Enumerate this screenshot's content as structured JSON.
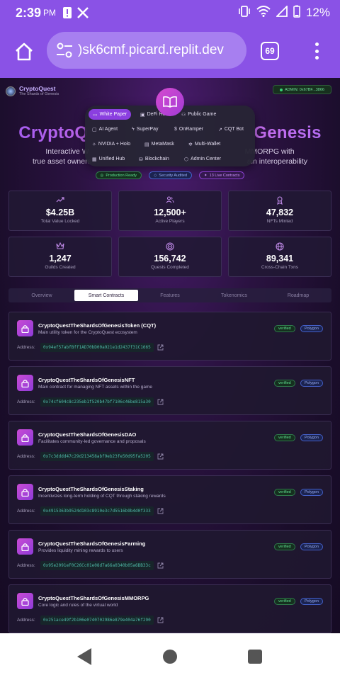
{
  "status_bar": {
    "time": "2:39",
    "ampm": "PM",
    "battery": "12%"
  },
  "browser": {
    "url": ")sk6cmf.picard.replit.dev",
    "tab_count": "69"
  },
  "site": {
    "brand_name": "CryptoQuest",
    "brand_sub": "The Shards of Genesis",
    "admin_label": "ADMIN: 0x67BF...3866",
    "hero_title": "CryptoQuest: The Shards of Genesis",
    "hero_title_left": "CryptoQ",
    "hero_title_right": "Genesis",
    "hero_desc_l1_left": "Interactive W",
    "hero_desc_l1_right": "MMORPG with",
    "hero_desc_l2_left": "true asset owners",
    "hero_desc_l2_right": "ain interoperability"
  },
  "menu": {
    "items": [
      {
        "label": "White Paper",
        "icon": "book-icon"
      },
      {
        "label": "DeFi Hub",
        "icon": "bank-icon"
      },
      {
        "label": "Public Game",
        "icon": "users-icon"
      },
      {
        "label": "AI Agent",
        "icon": "robot-icon"
      },
      {
        "label": "SuperPay",
        "icon": "zap-icon"
      },
      {
        "label": "OnRamper",
        "icon": "dollar-icon"
      },
      {
        "label": "CQT Bot",
        "icon": "trend-icon"
      },
      {
        "label": "NVIDIA + Holo",
        "icon": "sparkle-icon"
      },
      {
        "label": "MetaMask",
        "icon": "wallet-icon"
      },
      {
        "label": "Multi-Wallet",
        "icon": "hub-icon"
      },
      {
        "label": "Unified Hub",
        "icon": "layers-icon"
      },
      {
        "label": "Blockchain",
        "icon": "database-icon"
      },
      {
        "label": "Admin Center",
        "icon": "shield-icon"
      }
    ]
  },
  "badges": [
    {
      "label": "Production Ready"
    },
    {
      "label": "Security Audited"
    },
    {
      "label": "13 Live Contracts"
    }
  ],
  "stats": [
    {
      "value": "$4.25B",
      "label": "Total Value Locked",
      "icon": "trending-up-icon"
    },
    {
      "value": "12,500+",
      "label": "Active Players",
      "icon": "users-icon"
    },
    {
      "value": "47,832",
      "label": "NFTs Minted",
      "icon": "award-icon"
    },
    {
      "value": "1,247",
      "label": "Guilds Created",
      "icon": "crown-icon"
    },
    {
      "value": "156,742",
      "label": "Quests Completed",
      "icon": "target-icon"
    },
    {
      "value": "89,341",
      "label": "Cross-Chain Txns",
      "icon": "globe-icon"
    }
  ],
  "tabs": [
    {
      "label": "Overview"
    },
    {
      "label": "Smart Contracts"
    },
    {
      "label": "Features"
    },
    {
      "label": "Tokenomics"
    },
    {
      "label": "Roadmap"
    }
  ],
  "address_label": "Address:",
  "contracts": [
    {
      "name": "CryptoQuestTheShardsOfGenesisToken (CQT)",
      "desc": "Main utility token for the CryptoQuest ecosystem",
      "verified": "verified",
      "network": "Polygon",
      "address": "0x94ef57abfBff1AD70bD00a921e1d2437f31C1665"
    },
    {
      "name": "CryptoQuestTheShardsOfGenesisNFT",
      "desc": "Main contract for managing NFT assets within the game",
      "verified": "verified",
      "network": "Polygon",
      "address": "0x74cf604c8c235eb1f520b47bf7106c46be815a30"
    },
    {
      "name": "CryptoQuestTheShardsOfGenesisDAO",
      "desc": "Facilitates community-led governance and proposals",
      "verified": "verified",
      "network": "Polygon",
      "address": "0x7c3dddd47c29d213458abf9eb23fe50d95fa5205"
    },
    {
      "name": "CryptoQuestTheShardsOfGenesisStaking",
      "desc": "Incentivizes long-term holding of CQT through staking rewards",
      "verified": "verified",
      "network": "Polygon",
      "address": "0x4915363b9524d103c8910e3c7d5516b9b4d0f333"
    },
    {
      "name": "CryptoQuestTheShardsOfGenesisFarming",
      "desc": "Provides liquidity mining rewards to users",
      "verified": "verified",
      "network": "Polygon",
      "address": "0x95e2091eF0C26Cc01e08d7a66a0340b05a6BB33c"
    },
    {
      "name": "CryptoQuestTheShardsOfGenesisMMORPG",
      "desc": "Core logic and rules of the virtual world",
      "verified": "verified",
      "network": "Polygon",
      "address": "0x251ace49f2b106e0740702986e879e404a76f290"
    }
  ],
  "colors": {
    "browser_bar": "#8a52e6",
    "accent": "#8b3fe0",
    "verified_green": "#5ee08f",
    "polygon_blue": "#98aef5"
  }
}
